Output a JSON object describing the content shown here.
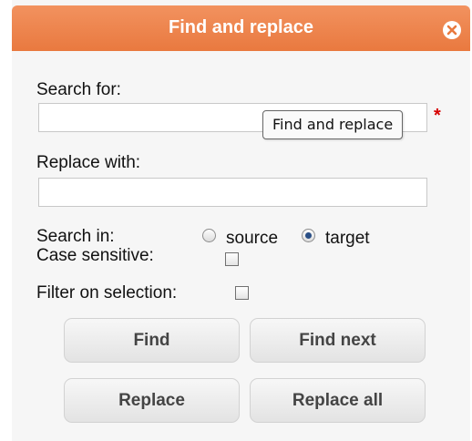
{
  "dialog": {
    "title": "Find and replace",
    "close_icon": "close-icon"
  },
  "search": {
    "label": "Search for:",
    "value": "",
    "required_mark": "*",
    "tooltip": "Find and replace"
  },
  "replace": {
    "label": "Replace with:",
    "value": ""
  },
  "search_in": {
    "label": "Search in:",
    "options": [
      {
        "label": "source",
        "checked": false
      },
      {
        "label": "target",
        "checked": true
      }
    ]
  },
  "case_sensitive": {
    "label": "Case sensitive:",
    "checked": false
  },
  "filter_selection": {
    "label": "Filter on selection:",
    "checked": false
  },
  "buttons": {
    "find": "Find",
    "find_next": "Find next",
    "replace": "Replace",
    "replace_all": "Replace all"
  },
  "colors": {
    "titlebar": "#ee8550",
    "required": "#d60000",
    "radio_selected": "#2a4f86"
  }
}
